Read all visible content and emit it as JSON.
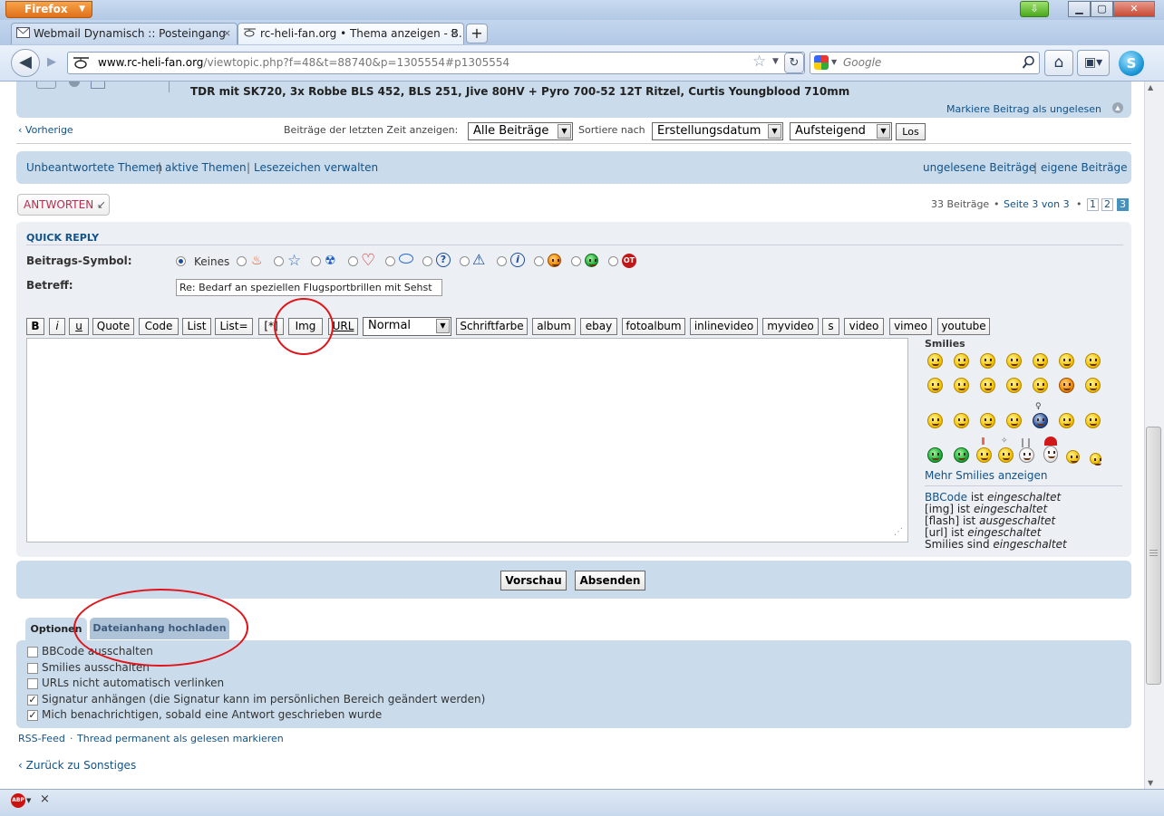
{
  "browser": {
    "firefox_label": "Firefox",
    "tabs": [
      {
        "title": "Webmail Dynamisch :: Posteingang"
      },
      {
        "title": "rc-heli-fan.org • Thema anzeigen - B..."
      }
    ],
    "new_tab_label": "+",
    "url_host": "www.rc-heli-fan.org",
    "url_path": "/viewtopic.php?f=48&t=88740&p=1305554#p1305554",
    "search_placeholder": "Google",
    "close_glyph": "×"
  },
  "post_top": {
    "signature": "TDR mit SK720, 3x Robbe BLS 452, BLS 251, Jive 80HV + Pyro 700-52 12T Ritzel, Curtis Youngblood 710mm",
    "mark_unread": "Markiere Beitrag als ungelesen"
  },
  "sortbar": {
    "prev": "Vorherige",
    "show_label": "Beiträge der letzten Zeit anzeigen:",
    "show_value": "Alle Beiträge",
    "sort_label": "Sortiere nach",
    "sort_value": "Erstellungsdatum",
    "order_value": "Aufsteigend",
    "go": "Los"
  },
  "navlinks": {
    "unanswered": "Unbeantwortete Themen",
    "active": "aktive Themen",
    "bookmarks": "Lesezeichen verwalten",
    "unread": "ungelesene Beiträge",
    "own": "eigene Beiträge",
    "sep": "|"
  },
  "pagination": {
    "reply": "ANTWORTEN",
    "count": "33 Beiträge",
    "page_info": "Seite 3 von 3",
    "bullet": "•",
    "pages": [
      "1",
      "2",
      "3"
    ]
  },
  "quick_reply": {
    "heading": "QUICK REPLY",
    "symbol_label": "Beitrags-Symbol:",
    "none_label": "Keines",
    "subject_label": "Betreff:",
    "subject_value": "Re: Bedarf an speziellen Flugsportbrillen mit Sehst"
  },
  "toolbar": {
    "bold": "B",
    "italic": "i",
    "underline": "u",
    "quote": "Quote",
    "code": "Code",
    "list": "List",
    "list_eq": "List=",
    "star": "[*]",
    "img": "Img",
    "url": "URL",
    "size": "Normal",
    "color": "Schriftfarbe",
    "album": "album",
    "ebay": "ebay",
    "fotoalbum": "fotoalbum",
    "inlinevideo": "inlinevideo",
    "myvideo": "myvideo",
    "s": "s",
    "video": "video",
    "vimeo": "vimeo",
    "youtube": "youtube"
  },
  "smilies": {
    "heading": "Smilies",
    "more": "Mehr Smilies anzeigen",
    "bbcode": "BBCode",
    "is": "ist",
    "are": "sind",
    "on": "eingeschaltet",
    "off": "ausgeschaltet",
    "img": "[img]",
    "flash": "[flash]",
    "url": "[url]",
    "smilies_word": "Smilies"
  },
  "actions": {
    "preview": "Vorschau",
    "submit": "Absenden"
  },
  "options": {
    "tab_options": "Optionen",
    "tab_upload": "Dateianhang hochladen",
    "items": [
      {
        "label": "BBCode ausschalten",
        "checked": false
      },
      {
        "label": "Smilies ausschalten",
        "checked": false
      },
      {
        "label": "URLs nicht automatisch verlinken",
        "checked": false
      },
      {
        "label": "Signatur anhängen (die Signatur kann im persönlichen Bereich geändert werden)",
        "checked": true
      },
      {
        "label": "Mich benachrichtigen, sobald eine Antwort geschrieben wurde",
        "checked": true
      }
    ],
    "check_glyph": "✓"
  },
  "footer": {
    "rss": "RSS-Feed",
    "dot": "·",
    "mark_read": "Thread permanent als gelesen markieren",
    "back": "Zurück zu Sonstiges"
  },
  "colors": {
    "link": "#105289",
    "panel": "#cadceb",
    "annotation_red": "#e0141a",
    "reply_red": "#bc2a4d"
  }
}
